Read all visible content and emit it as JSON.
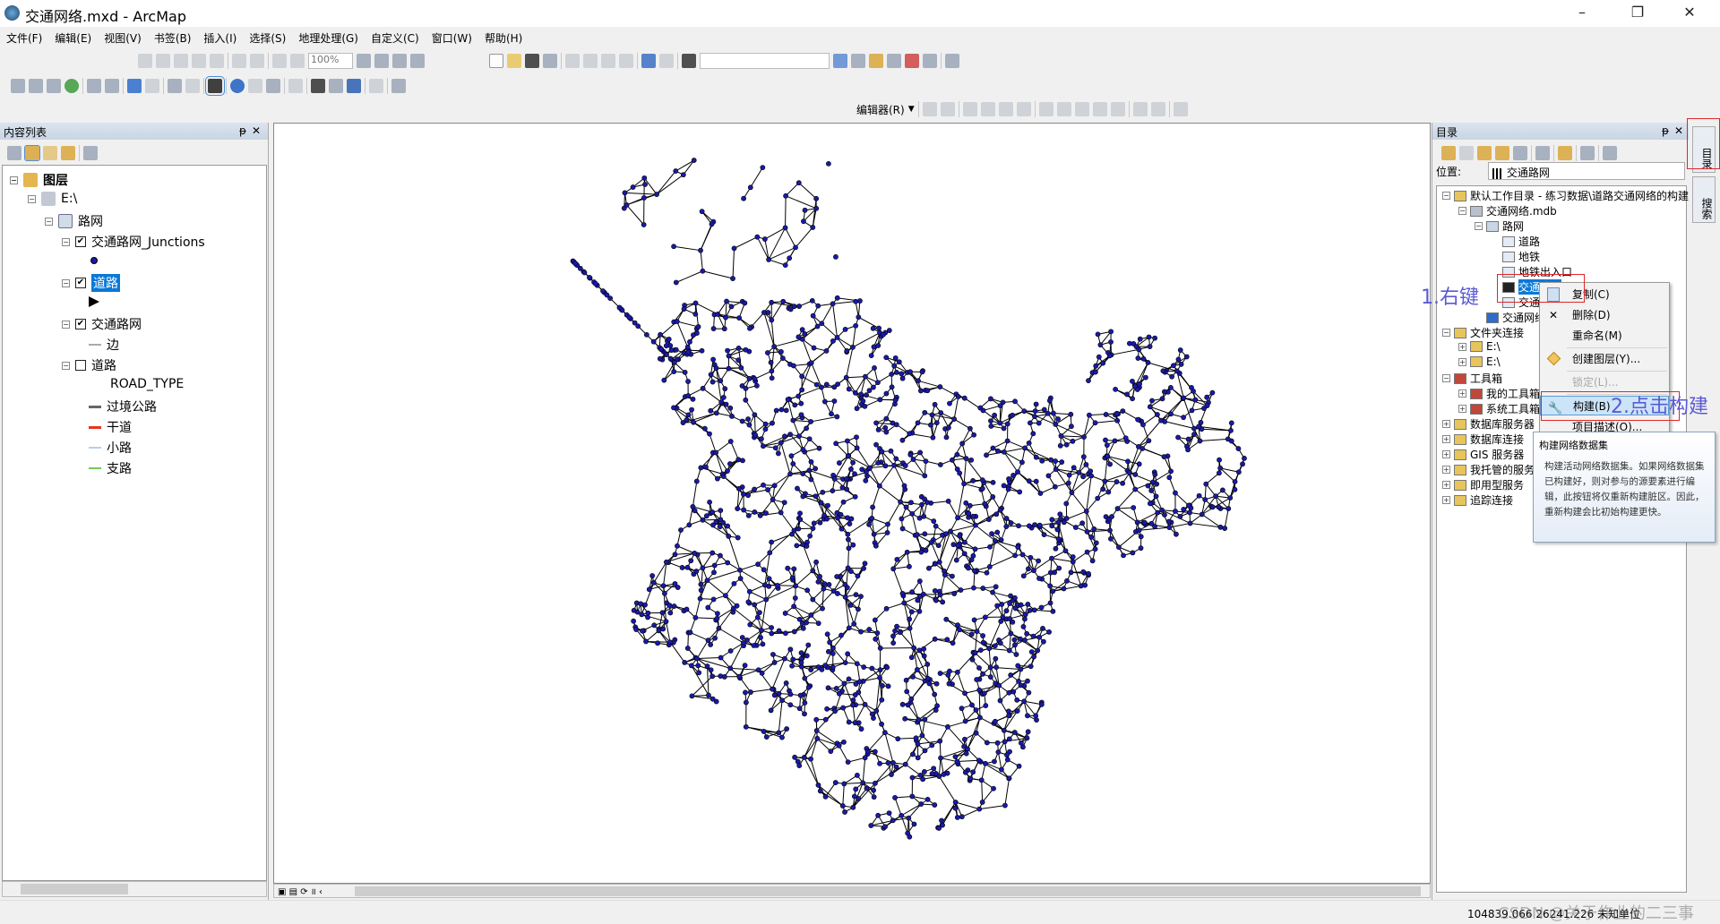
{
  "window": {
    "title": "交通网络.mxd - ArcMap"
  },
  "menu": [
    "文件(F)",
    "编辑(E)",
    "视图(V)",
    "书签(B)",
    "插入(I)",
    "选择(S)",
    "地理处理(G)",
    "自定义(C)",
    "窗口(W)",
    "帮助(H)"
  ],
  "toolbar": {
    "zoom_value": "100%",
    "editor_label": "编辑器(R)"
  },
  "toc": {
    "title": "内容列表",
    "root": "图层",
    "db": "E:\\",
    "dataset": "路网",
    "layers": [
      {
        "name": "交通路网_Junctions",
        "checked": true
      },
      {
        "name": "道路",
        "checked": true,
        "selected": true
      },
      {
        "name": "交通路网",
        "checked": true
      },
      {
        "name": "道路",
        "checked": false
      }
    ],
    "edge_label": "边",
    "field": "ROAD_TYPE",
    "classes": [
      {
        "label": "过境公路",
        "color": "#666666"
      },
      {
        "label": "干道",
        "color": "#e8351f"
      },
      {
        "label": "小路",
        "color": "#b6cdf0"
      },
      {
        "label": "支路",
        "color": "#7cc45a"
      }
    ]
  },
  "catalog": {
    "title": "目录",
    "location_label": "位置:",
    "location_value": "交通路网",
    "items": [
      "默认工作目录 - 练习数据\\道路交通网络的构建",
      "交通网络.mdb",
      "路网",
      "道路",
      "地铁",
      "地铁出入口",
      "交通路网",
      "交通路网_Junctions",
      "交通网络.mxd",
      "文件夹连接",
      "E:\\",
      "E:\\",
      "工具箱",
      "我的工具箱",
      "系统工具箱",
      "数据库服务器",
      "数据库连接",
      "GIS 服务器",
      "我托管的服务",
      "即用型服务",
      "追踪连接"
    ],
    "side_tabs": [
      "目录",
      "搜索"
    ]
  },
  "context_menu": {
    "items": [
      "复制(C)",
      "删除(D)",
      "重命名(M)",
      "创建图层(Y)...",
      "锁定(L)...",
      "构建(B)",
      "项目描述(O)..."
    ]
  },
  "tooltip": {
    "title": "构建网络数据集",
    "body": "构建活动网络数据集。如果网络数据集已构建好，则对参与的源要素进行编辑，此按钮将仅重新构建脏区。因此，重新构建会比初始构建更快。"
  },
  "annotations": {
    "step1": "1.右键",
    "step2": "2.点击构建"
  },
  "status": {
    "coords": "104839.066  26241.226 未知单位",
    "watermark": "CSDN @关于作业的二三事"
  },
  "colors": {
    "junction": "#1a1aa8",
    "selection": "#0a78d7",
    "annotation": "#5a5ad6",
    "highlight_box": "#e0262a"
  }
}
